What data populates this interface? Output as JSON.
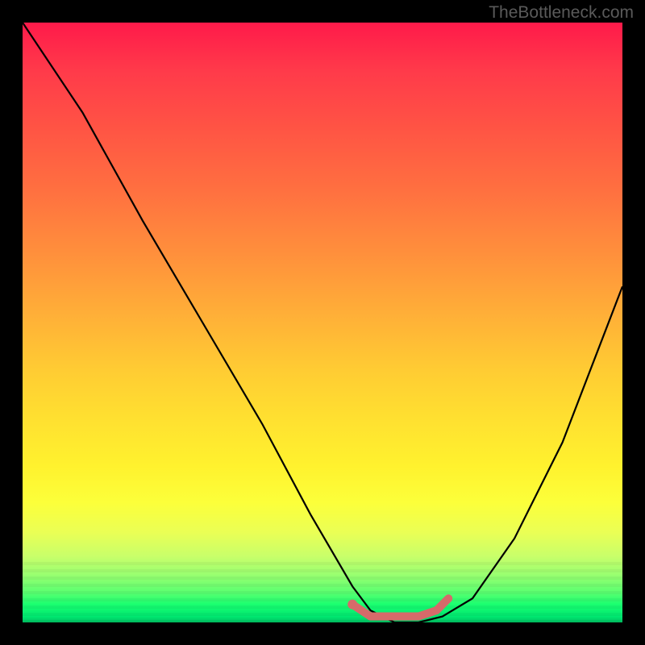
{
  "watermark": "TheBottleneck.com",
  "chart_data": {
    "type": "line",
    "title": "",
    "xlabel": "",
    "ylabel": "",
    "xlim": [
      0,
      100
    ],
    "ylim": [
      0,
      100
    ],
    "series": [
      {
        "name": "bottleneck-curve",
        "x": [
          0,
          10,
          20,
          30,
          40,
          48,
          55,
          58,
          62,
          66,
          70,
          75,
          82,
          90,
          100
        ],
        "y": [
          100,
          85,
          67,
          50,
          33,
          18,
          6,
          2,
          0,
          0,
          1,
          4,
          14,
          30,
          56
        ],
        "color": "#000000"
      },
      {
        "name": "optimal-range-marker",
        "x": [
          55,
          58,
          60,
          63,
          66,
          69,
          71
        ],
        "y": [
          3,
          1,
          1,
          1,
          1,
          2,
          4
        ],
        "color": "#d66a6a"
      }
    ],
    "annotations": []
  },
  "colors": {
    "background": "#000000",
    "gradient_top": "#ff1a4a",
    "gradient_bottom": "#00c060",
    "curve": "#000000",
    "marker": "#d66a6a",
    "watermark": "#5a5a5a"
  }
}
